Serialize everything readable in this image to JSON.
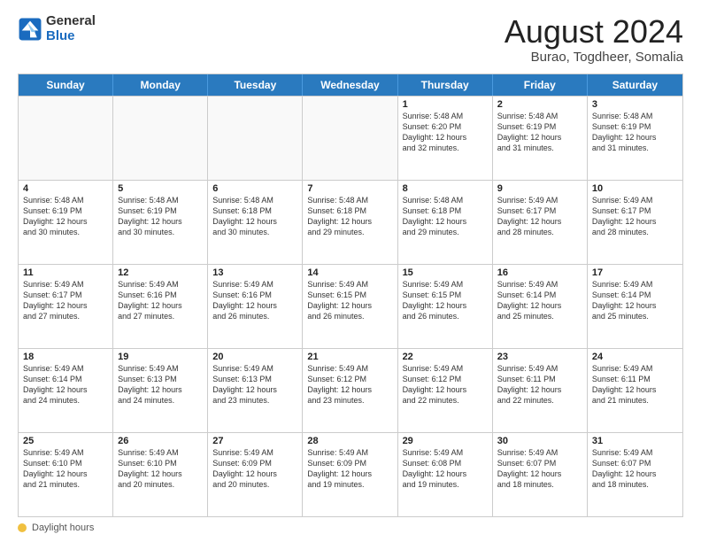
{
  "logo": {
    "general": "General",
    "blue": "Blue"
  },
  "title": {
    "month": "August 2024",
    "location": "Burao, Togdheer, Somalia"
  },
  "header_days": [
    "Sunday",
    "Monday",
    "Tuesday",
    "Wednesday",
    "Thursday",
    "Friday",
    "Saturday"
  ],
  "footer": {
    "label": "Daylight hours"
  },
  "weeks": [
    [
      {
        "day": "",
        "text": "",
        "empty": true
      },
      {
        "day": "",
        "text": "",
        "empty": true
      },
      {
        "day": "",
        "text": "",
        "empty": true
      },
      {
        "day": "",
        "text": "",
        "empty": true
      },
      {
        "day": "1",
        "text": "Sunrise: 5:48 AM\nSunset: 6:20 PM\nDaylight: 12 hours\nand 32 minutes.",
        "empty": false
      },
      {
        "day": "2",
        "text": "Sunrise: 5:48 AM\nSunset: 6:19 PM\nDaylight: 12 hours\nand 31 minutes.",
        "empty": false
      },
      {
        "day": "3",
        "text": "Sunrise: 5:48 AM\nSunset: 6:19 PM\nDaylight: 12 hours\nand 31 minutes.",
        "empty": false
      }
    ],
    [
      {
        "day": "4",
        "text": "Sunrise: 5:48 AM\nSunset: 6:19 PM\nDaylight: 12 hours\nand 30 minutes.",
        "empty": false
      },
      {
        "day": "5",
        "text": "Sunrise: 5:48 AM\nSunset: 6:19 PM\nDaylight: 12 hours\nand 30 minutes.",
        "empty": false
      },
      {
        "day": "6",
        "text": "Sunrise: 5:48 AM\nSunset: 6:18 PM\nDaylight: 12 hours\nand 30 minutes.",
        "empty": false
      },
      {
        "day": "7",
        "text": "Sunrise: 5:48 AM\nSunset: 6:18 PM\nDaylight: 12 hours\nand 29 minutes.",
        "empty": false
      },
      {
        "day": "8",
        "text": "Sunrise: 5:48 AM\nSunset: 6:18 PM\nDaylight: 12 hours\nand 29 minutes.",
        "empty": false
      },
      {
        "day": "9",
        "text": "Sunrise: 5:49 AM\nSunset: 6:17 PM\nDaylight: 12 hours\nand 28 minutes.",
        "empty": false
      },
      {
        "day": "10",
        "text": "Sunrise: 5:49 AM\nSunset: 6:17 PM\nDaylight: 12 hours\nand 28 minutes.",
        "empty": false
      }
    ],
    [
      {
        "day": "11",
        "text": "Sunrise: 5:49 AM\nSunset: 6:17 PM\nDaylight: 12 hours\nand 27 minutes.",
        "empty": false
      },
      {
        "day": "12",
        "text": "Sunrise: 5:49 AM\nSunset: 6:16 PM\nDaylight: 12 hours\nand 27 minutes.",
        "empty": false
      },
      {
        "day": "13",
        "text": "Sunrise: 5:49 AM\nSunset: 6:16 PM\nDaylight: 12 hours\nand 26 minutes.",
        "empty": false
      },
      {
        "day": "14",
        "text": "Sunrise: 5:49 AM\nSunset: 6:15 PM\nDaylight: 12 hours\nand 26 minutes.",
        "empty": false
      },
      {
        "day": "15",
        "text": "Sunrise: 5:49 AM\nSunset: 6:15 PM\nDaylight: 12 hours\nand 26 minutes.",
        "empty": false
      },
      {
        "day": "16",
        "text": "Sunrise: 5:49 AM\nSunset: 6:14 PM\nDaylight: 12 hours\nand 25 minutes.",
        "empty": false
      },
      {
        "day": "17",
        "text": "Sunrise: 5:49 AM\nSunset: 6:14 PM\nDaylight: 12 hours\nand 25 minutes.",
        "empty": false
      }
    ],
    [
      {
        "day": "18",
        "text": "Sunrise: 5:49 AM\nSunset: 6:14 PM\nDaylight: 12 hours\nand 24 minutes.",
        "empty": false
      },
      {
        "day": "19",
        "text": "Sunrise: 5:49 AM\nSunset: 6:13 PM\nDaylight: 12 hours\nand 24 minutes.",
        "empty": false
      },
      {
        "day": "20",
        "text": "Sunrise: 5:49 AM\nSunset: 6:13 PM\nDaylight: 12 hours\nand 23 minutes.",
        "empty": false
      },
      {
        "day": "21",
        "text": "Sunrise: 5:49 AM\nSunset: 6:12 PM\nDaylight: 12 hours\nand 23 minutes.",
        "empty": false
      },
      {
        "day": "22",
        "text": "Sunrise: 5:49 AM\nSunset: 6:12 PM\nDaylight: 12 hours\nand 22 minutes.",
        "empty": false
      },
      {
        "day": "23",
        "text": "Sunrise: 5:49 AM\nSunset: 6:11 PM\nDaylight: 12 hours\nand 22 minutes.",
        "empty": false
      },
      {
        "day": "24",
        "text": "Sunrise: 5:49 AM\nSunset: 6:11 PM\nDaylight: 12 hours\nand 21 minutes.",
        "empty": false
      }
    ],
    [
      {
        "day": "25",
        "text": "Sunrise: 5:49 AM\nSunset: 6:10 PM\nDaylight: 12 hours\nand 21 minutes.",
        "empty": false
      },
      {
        "day": "26",
        "text": "Sunrise: 5:49 AM\nSunset: 6:10 PM\nDaylight: 12 hours\nand 20 minutes.",
        "empty": false
      },
      {
        "day": "27",
        "text": "Sunrise: 5:49 AM\nSunset: 6:09 PM\nDaylight: 12 hours\nand 20 minutes.",
        "empty": false
      },
      {
        "day": "28",
        "text": "Sunrise: 5:49 AM\nSunset: 6:09 PM\nDaylight: 12 hours\nand 19 minutes.",
        "empty": false
      },
      {
        "day": "29",
        "text": "Sunrise: 5:49 AM\nSunset: 6:08 PM\nDaylight: 12 hours\nand 19 minutes.",
        "empty": false
      },
      {
        "day": "30",
        "text": "Sunrise: 5:49 AM\nSunset: 6:07 PM\nDaylight: 12 hours\nand 18 minutes.",
        "empty": false
      },
      {
        "day": "31",
        "text": "Sunrise: 5:49 AM\nSunset: 6:07 PM\nDaylight: 12 hours\nand 18 minutes.",
        "empty": false
      }
    ]
  ]
}
